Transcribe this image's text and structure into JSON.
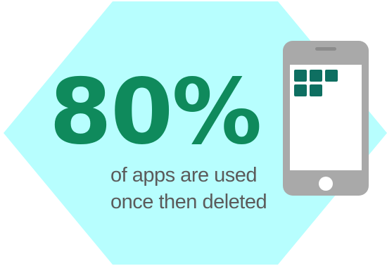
{
  "stat": {
    "value": "80%"
  },
  "caption": {
    "line1": "of apps are used",
    "line2": "once then deleted"
  },
  "phone": {
    "icon": "smartphone-icon",
    "app_tile_count": 5
  },
  "colors": {
    "background": "#ffffff",
    "hexagon": "#b7fefe",
    "stat_text": "#0f8a5c",
    "caption_text": "#5b5b5b",
    "phone_body": "#a9a9a9",
    "phone_screen": "#ffffff",
    "app_tile": "#0e6f61"
  }
}
